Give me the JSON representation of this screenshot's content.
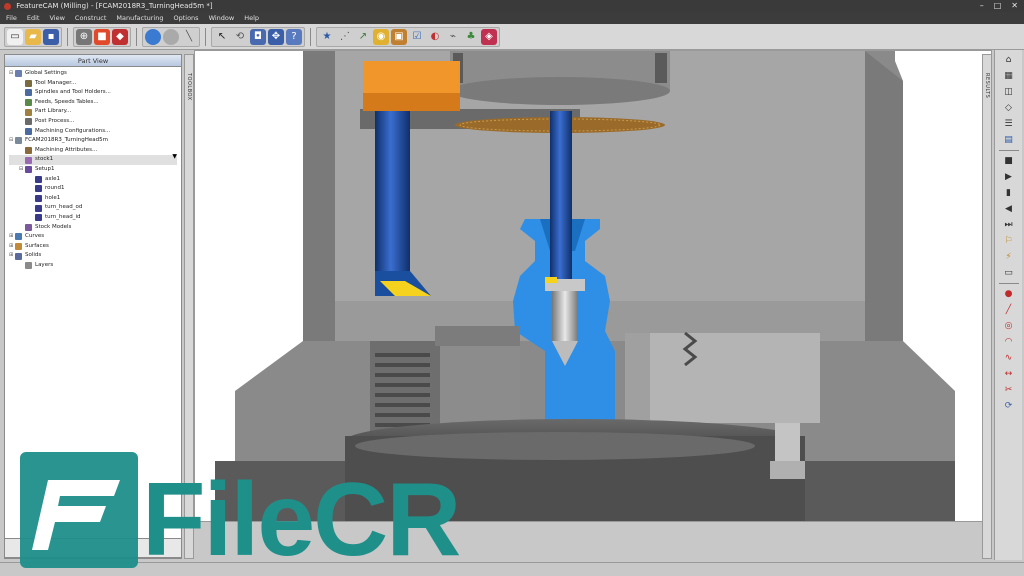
{
  "window": {
    "title": "FeatureCAM (Milling) - [FCAM2018R3_TurningHead5m *]",
    "controls": [
      "–",
      "□",
      "✕"
    ]
  },
  "menu": [
    "File",
    "Edit",
    "View",
    "Construct",
    "Manufacturing",
    "Options",
    "Window",
    "Help"
  ],
  "part_view": {
    "title": "Part View",
    "items": [
      {
        "label": "Global Settings",
        "level": 0,
        "color": "#6a7fb0",
        "expander": "⊟"
      },
      {
        "label": "Tool Manager...",
        "level": 1,
        "color": "#7a6a40"
      },
      {
        "label": "Spindles and Tool Holders...",
        "level": 1,
        "color": "#4a6aa0"
      },
      {
        "label": "Feeds, Speeds Tables...",
        "level": 1,
        "color": "#5a8a4a"
      },
      {
        "label": "Part Library...",
        "level": 1,
        "color": "#a08040"
      },
      {
        "label": "Post Process...",
        "level": 1,
        "color": "#6a6a6a"
      },
      {
        "label": "Machining Configurations...",
        "level": 1,
        "color": "#4a6aa0"
      },
      {
        "label": "FCAM2018R3_TurningHead5m",
        "level": 0,
        "color": "#7a8a9a",
        "expander": "⊟"
      },
      {
        "label": "Machining Attributes...",
        "level": 1,
        "color": "#8a6a3a"
      },
      {
        "label": "stock1",
        "level": 1,
        "color": "#9a6ab0",
        "highlight": true
      },
      {
        "label": "Setup1",
        "level": 1,
        "color": "#6a4a9a",
        "expander": "⊟"
      },
      {
        "label": "axle1",
        "level": 2,
        "color": "#3a3a8a"
      },
      {
        "label": "round1",
        "level": 2,
        "color": "#3a3a8a"
      },
      {
        "label": "hole1",
        "level": 2,
        "color": "#3a3a8a"
      },
      {
        "label": "turn_head_od",
        "level": 2,
        "color": "#3a3a8a"
      },
      {
        "label": "turn_head_id",
        "level": 2,
        "color": "#3a3a8a"
      },
      {
        "label": "Stock Models",
        "level": 1,
        "color": "#7a5a9a"
      },
      {
        "label": "Curves",
        "level": 0,
        "color": "#4a7ab0",
        "expander": "⊞"
      },
      {
        "label": "Surfaces",
        "level": 0,
        "color": "#c08a3a",
        "expander": "⊞"
      },
      {
        "label": "Solids",
        "level": 0,
        "color": "#5a6a9a",
        "expander": "⊞"
      },
      {
        "label": "Layers",
        "level": 1,
        "color": "#8a8a8a"
      }
    ]
  },
  "strips": {
    "left": "TOOLBOX",
    "right": "RESULTS"
  },
  "watermark": "FileCR",
  "status": "",
  "colors": {
    "accent_blue": "#2f8fe6",
    "holder_orange": "#f0962a",
    "insert_yellow": "#f5d21e",
    "tool_blue": "#1a4fa0",
    "machine_gray": "#8c8c8c",
    "watermark_teal": "#1f8f8a"
  }
}
